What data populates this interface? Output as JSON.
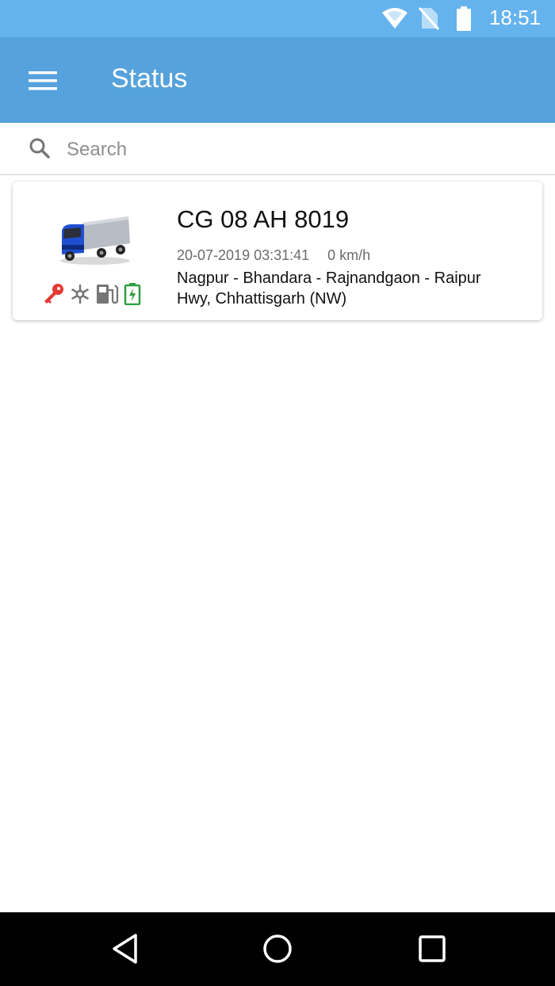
{
  "status_bar": {
    "time": "18:51",
    "icons": [
      "wifi-icon",
      "no-sim-icon",
      "battery-icon"
    ]
  },
  "app_bar": {
    "title": "Status",
    "menu_icon": "menu-icon"
  },
  "search": {
    "placeholder": "Search",
    "value": ""
  },
  "vehicles": [
    {
      "registration": "CG 08 AH 8019",
      "timestamp": "20-07-2019 03:31:41",
      "speed": "0 km/h",
      "address_line1": "Nagpur - Bhandara - Rajnandgaon - Raipur",
      "address_line2": "Hwy, Chhattisgarh (NW)",
      "status_icons": [
        "ignition-key-icon",
        "ac-snowflake-icon",
        "fuel-pump-icon",
        "battery-charging-icon"
      ],
      "colors": {
        "ignition": "#e53935",
        "ac": "#757575",
        "fuel": "#757575",
        "battery": "#2e9e3e",
        "truck_cab": "#1f4fd0"
      }
    }
  ],
  "nav_bar": [
    "back-icon",
    "home-icon",
    "recents-icon"
  ],
  "colors": {
    "status_bar": "#64b3ed",
    "app_bar": "#55a2dc"
  }
}
